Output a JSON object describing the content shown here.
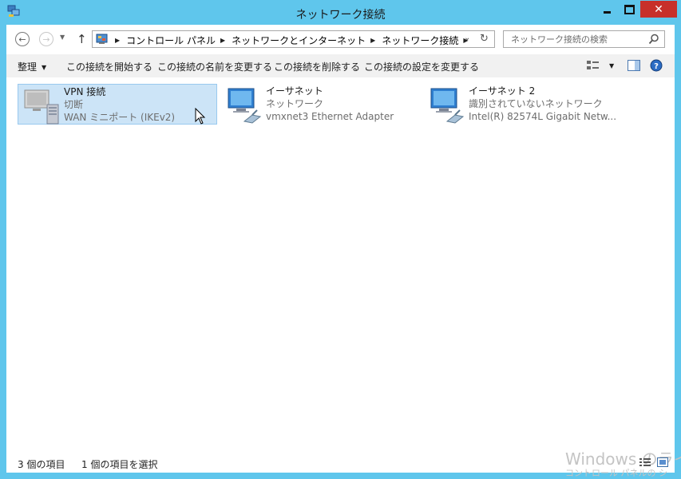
{
  "window": {
    "title": "ネットワーク接続",
    "minimize_label": "",
    "close_symbol": "✕"
  },
  "address_bar": {
    "crumbs": [
      "コントロール パネル",
      "ネットワークとインターネット",
      "ネットワーク接続"
    ]
  },
  "search": {
    "placeholder": "ネットワーク接続の検索",
    "value": ""
  },
  "toolbar": {
    "organize": "整理",
    "start": "この接続を開始する",
    "rename": "この接続の名前を変更する",
    "delete": "この接続を削除する",
    "settings": "この接続の設定を変更する"
  },
  "connections": [
    {
      "name": "VPN 接続",
      "status": "切断",
      "device": "WAN ミニポート (IKEv2)",
      "selected": true,
      "icon": "vpn-connection-icon"
    },
    {
      "name": "イーサネット",
      "status": "ネットワーク",
      "device": "vmxnet3 Ethernet Adapter",
      "selected": false,
      "icon": "ethernet-connection-icon"
    },
    {
      "name": "イーサネット 2",
      "status": "識別されていないネットワーク",
      "device": "Intel(R) 82574L Gigabit Netw...",
      "selected": false,
      "icon": "ethernet-connection-icon"
    }
  ],
  "status_bar": {
    "count": "3 個の項目",
    "selection": "1 個の項目を選択"
  },
  "watermark": {
    "line1": "Windows のライ",
    "line2": "コントロール パネルの シ"
  },
  "colors": {
    "frame": "#5fc6ec",
    "close_button": "#c7302a",
    "selection_fill": "#cce4f7",
    "selection_border": "#99c9ef",
    "command_bar": "#f1f1f1"
  }
}
